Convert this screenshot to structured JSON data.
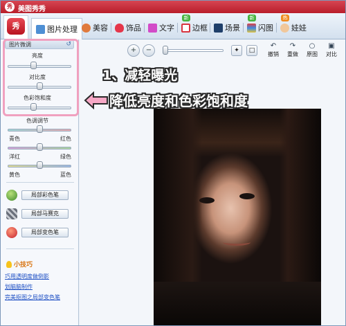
{
  "app": {
    "title": "美图秀秀",
    "logo_text": "秀"
  },
  "tabs": [
    {
      "label": "图片处理",
      "active": true
    },
    {
      "label": "美容"
    },
    {
      "label": "饰品"
    },
    {
      "label": "文字"
    },
    {
      "label": "边框",
      "badge": "新"
    },
    {
      "label": "场景"
    },
    {
      "label": "闪图",
      "badge": "新"
    },
    {
      "label": "娃娃",
      "badge": "热"
    }
  ],
  "panel": {
    "header": "图片微调",
    "sliders": [
      {
        "label": "亮度",
        "value": 0.45
      },
      {
        "label": "对比度",
        "value": 0.55
      },
      {
        "label": "色彩饱和度",
        "value": 0.45
      },
      {
        "label": "色调调节"
      }
    ],
    "tone": [
      {
        "left": "青色",
        "right": "红色",
        "value": 0.5
      },
      {
        "left": "洋红",
        "right": "绿色",
        "value": 0.5
      },
      {
        "left": "黄色",
        "right": "蓝色",
        "value": 0.5
      }
    ],
    "tools": [
      "局部彩色笔",
      "局部马赛克",
      "局部变色笔"
    ]
  },
  "tips": {
    "title": "小技巧",
    "links": [
      "巧用透明度做倒影",
      "划脑脑制作",
      "完美抠图之局部变色笔"
    ]
  },
  "toolbar": {
    "actions": [
      "撤销",
      "重做",
      "原图",
      "对比"
    ],
    "zoom_level": 0.05
  },
  "annotations": {
    "step": "1、减轻曝光",
    "instruction": "降低亮度和色彩饱和度"
  },
  "colors": {
    "title_bar": "#c4222e",
    "highlight": "#f0a0bf",
    "link": "#1d4fc4",
    "tips": "#d8730f"
  }
}
